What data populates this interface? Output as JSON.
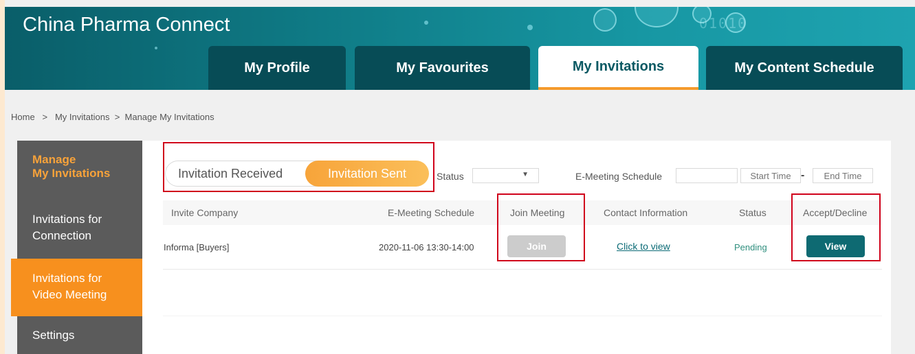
{
  "site": {
    "title": "China Pharma Connect"
  },
  "nav": {
    "tabs": [
      {
        "label": "My Profile",
        "active": false
      },
      {
        "label": "My Favourites",
        "active": false
      },
      {
        "label": "My Invitations",
        "active": true
      },
      {
        "label": "My Content Schedule",
        "active": false
      }
    ]
  },
  "breadcrumb": {
    "home": "Home",
    "sep": ">",
    "level1": "My Invitations",
    "level2": "Manage My Invitations"
  },
  "sidebar": {
    "heading_line1": "Manage",
    "heading_line2": "My Invitations",
    "items": [
      {
        "line1": "Invitations for",
        "line2": "Connection",
        "active": false
      },
      {
        "line1": "Invitations for",
        "line2": "Video Meeting",
        "active": true
      },
      {
        "line1": "Settings",
        "line2": "",
        "active": false
      }
    ]
  },
  "filters": {
    "toggle_received": "Invitation Received",
    "toggle_sent": "Invitation Sent",
    "toggle_selected": "Invitation Sent",
    "status_label": "Status",
    "status_value": "",
    "schedule_label": "E-Meeting Schedule",
    "start_placeholder": "Start Time",
    "end_placeholder": "End Time",
    "range_dash": "-"
  },
  "table": {
    "columns": [
      "Invite Company",
      "E-Meeting Schedule",
      "Join Meeting",
      "Contact Information",
      "Status",
      "Accept/Decline"
    ],
    "rows": [
      {
        "company": "Informa [Buyers]",
        "schedule": "2020-11-06 13:30-14:00",
        "join_label": "Join",
        "contact_label": "Click to view",
        "status": "Pending",
        "action_label": "View"
      }
    ]
  },
  "colors": {
    "brand_teal": "#0b5963",
    "accent_orange": "#f7901e",
    "join_disabled": "#cccccc",
    "view_button": "#0e6a72",
    "highlight_red": "#d0021b"
  },
  "icons": {
    "select_caret": "chevron-down-icon"
  }
}
